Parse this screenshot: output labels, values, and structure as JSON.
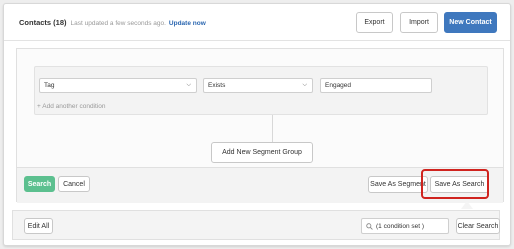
{
  "header": {
    "title": "Contacts (18)",
    "updated_text": "Last updated a few seconds ago.",
    "update_link": "Update now",
    "export_label": "Export",
    "import_label": "Import",
    "new_contact_label": "New Contact"
  },
  "condition": {
    "field_value": "Tag",
    "operator_value": "Exists",
    "value": "Engaged",
    "add_condition_label": "+ Add another condition"
  },
  "segment": {
    "add_group_label": "Add New Segment Group"
  },
  "actions": {
    "search_label": "Search",
    "cancel_label": "Cancel",
    "save_segment_label": "Save As Segment",
    "save_search_label": "Save As Search"
  },
  "bottom": {
    "edit_all_label": "Edit All",
    "search_summary": "(1 condition set )",
    "clear_search_label": "Clear Search"
  },
  "colors": {
    "primary": "#3f78be",
    "green": "#5cc08f",
    "highlight": "#d0241f",
    "link": "#2a66b0"
  },
  "icons": {
    "caret": "chevron-down-icon",
    "search": "search-icon"
  }
}
